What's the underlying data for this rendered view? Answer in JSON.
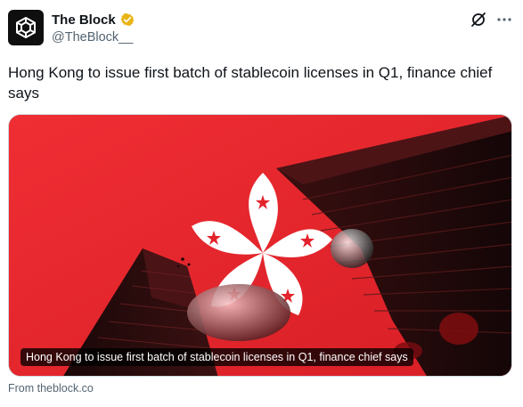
{
  "header": {
    "display_name": "The Block",
    "handle": "@TheBlock__",
    "avatar_icon": "the-block-cube-logo-icon",
    "verified_icon": "gold-verified-badge-icon",
    "grok_icon": "grok-icon",
    "more_icon": "more-options-icon",
    "verified_color": "#e8b416"
  },
  "tweet": {
    "text": "Hong Kong to issue first batch of stablecoin licenses in Q1, finance chief says"
  },
  "card": {
    "caption": "Hong Kong to issue first batch of stablecoin licenses in Q1, finance chief says",
    "image_desc_icon": "hong-kong-flag-skyscrapers-image",
    "background_color": "#e3232c"
  },
  "source": {
    "label": "From theblock.co"
  }
}
